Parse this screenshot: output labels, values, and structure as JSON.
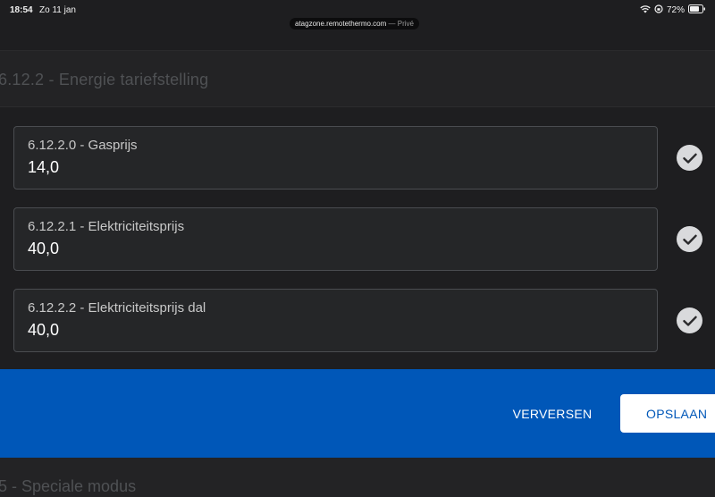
{
  "status_bar": {
    "time": "18:54",
    "date": "Zo 11 jan",
    "battery": "72%",
    "url": "atagzone.remotethermo.com",
    "url_suffix": " — Privé"
  },
  "section": {
    "title": "6.12.2 - Energie tariefstelling"
  },
  "fields": [
    {
      "label": "6.12.2.0 - Gasprijs",
      "value": "14,0"
    },
    {
      "label": "6.12.2.1 - Elektriciteitsprijs",
      "value": "40,0"
    },
    {
      "label": "6.12.2.2 - Elektriciteitsprijs dal",
      "value": "40,0"
    }
  ],
  "actions": {
    "refresh_label": "VERVERSEN",
    "save_label": "OPSLAAN"
  },
  "next_section": {
    "title": "5 - Speciale modus"
  },
  "colors": {
    "accent": "#0057b8",
    "background": "#1e1e20",
    "field_bg": "#252628",
    "check_bg": "#d9dadc"
  }
}
